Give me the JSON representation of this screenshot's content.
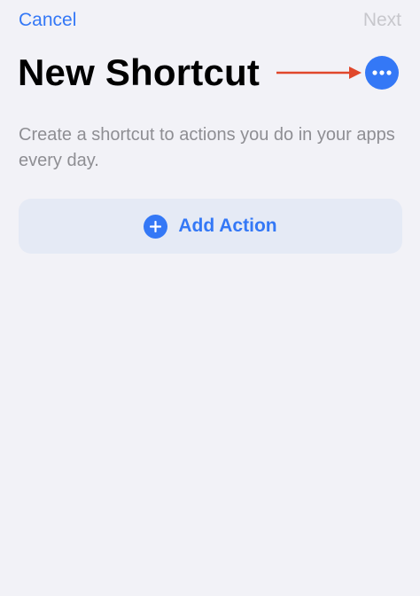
{
  "nav": {
    "cancel_label": "Cancel",
    "next_label": "Next"
  },
  "header": {
    "title": "New Shortcut",
    "more_icon": "ellipsis-circle-icon"
  },
  "annotation": {
    "arrow_color": "#e0472b",
    "target": "more-options-button"
  },
  "main": {
    "description": "Create a shortcut to actions you do in your apps every day.",
    "add_action": {
      "icon": "plus-circle-icon",
      "label": "Add Action"
    }
  },
  "colors": {
    "accent": "#3478f6",
    "background": "#f2f2f7",
    "card": "#e5eaf5",
    "disabled_text": "#c7c7cc",
    "secondary_text": "#8e8e93"
  }
}
